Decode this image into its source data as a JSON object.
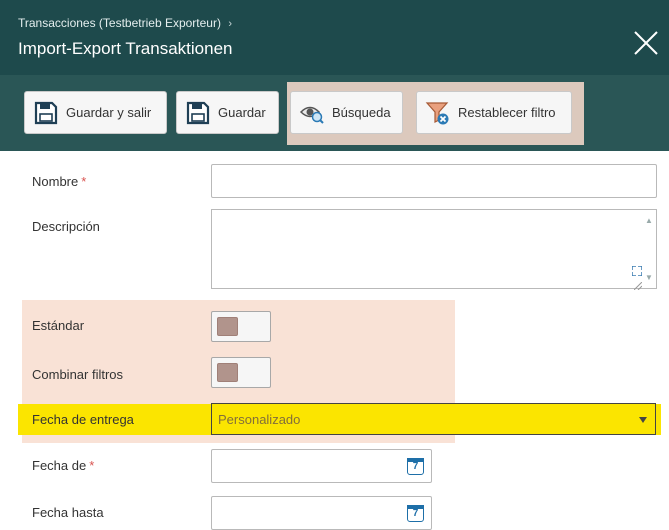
{
  "header": {
    "breadcrumb": "Transacciones (Testbetrieb Exporteur)",
    "breadcrumb_sep": "›",
    "title": "Import-Export Transaktionen",
    "close_icon": "close-icon"
  },
  "toolbar": {
    "save_exit_label": "Guardar y salir",
    "save_label": "Guardar",
    "search_label": "Búsqueda",
    "reset_filter_label": "Restablecer filtro"
  },
  "form": {
    "name_label": "Nombre",
    "required_mark": "*",
    "name_value": "",
    "description_label": "Descripción",
    "description_value": "",
    "standard_label": "Estándar",
    "combine_filters_label": "Combinar filtros",
    "delivery_date_label": "Fecha de entrega",
    "delivery_date_value": "Personalizado",
    "date_from_label": "Fecha de",
    "date_to_label": "Fecha hasta",
    "calendar_icon_text": "7"
  },
  "colors": {
    "header_bg": "#1e4a4c",
    "toolbar_bg": "#2a5656",
    "highlight_peach": "#f9e2d6",
    "highlight_yellow": "#fbe500",
    "required": "#d9534f"
  }
}
